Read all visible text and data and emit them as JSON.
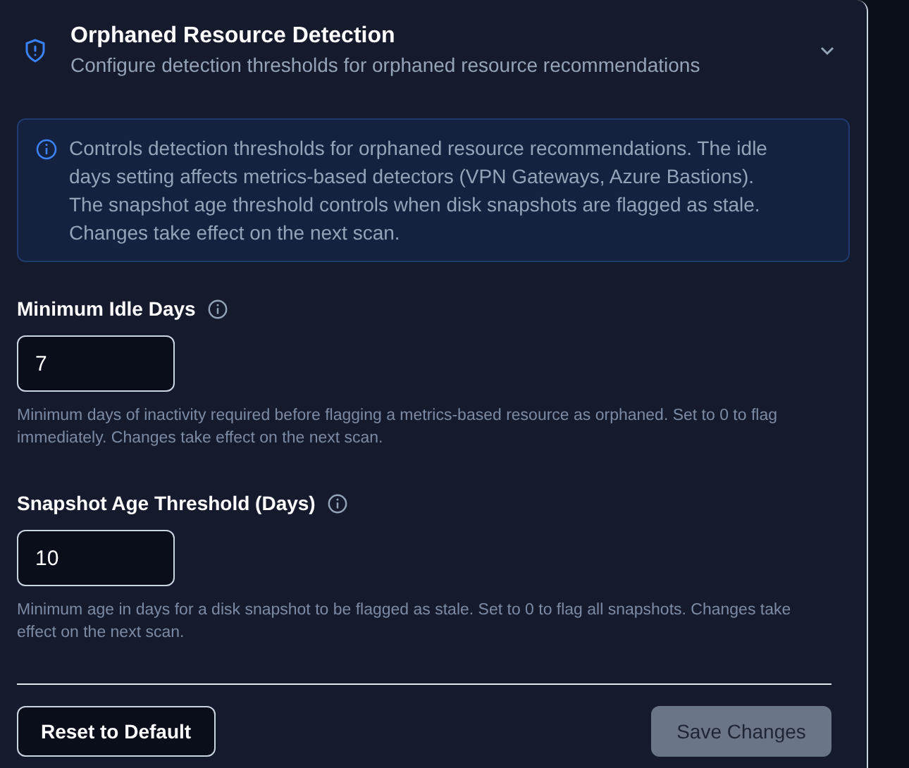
{
  "section": {
    "title": "Orphaned Resource Detection",
    "subtitle": "Configure detection thresholds for orphaned resource recommendations",
    "expanded": true
  },
  "info": "Controls detection thresholds for orphaned resource recommendations. The idle days setting affects metrics-based detectors (VPN Gateways, Azure Bastions). The snapshot age threshold controls when disk snapshots are flagged as stale. Changes take effect on the next scan.",
  "fields": [
    {
      "label": "Minimum Idle Days",
      "value": "7",
      "help": "Minimum days of inactivity required before flagging a metrics-based resource as orphaned. Set to 0 to flag immediately. Changes take effect on the next scan."
    },
    {
      "label": "Snapshot Age Threshold (Days)",
      "value": "10",
      "help": "Minimum age in days for a disk snapshot to be flagged as stale. Set to 0 to flag all snapshots. Changes take effect on the next scan."
    }
  ],
  "buttons": [
    {
      "label": "Reset to Default",
      "kind": "secondary",
      "disabled": false
    },
    {
      "label": "Save Changes",
      "kind": "primary",
      "disabled": true
    }
  ]
}
